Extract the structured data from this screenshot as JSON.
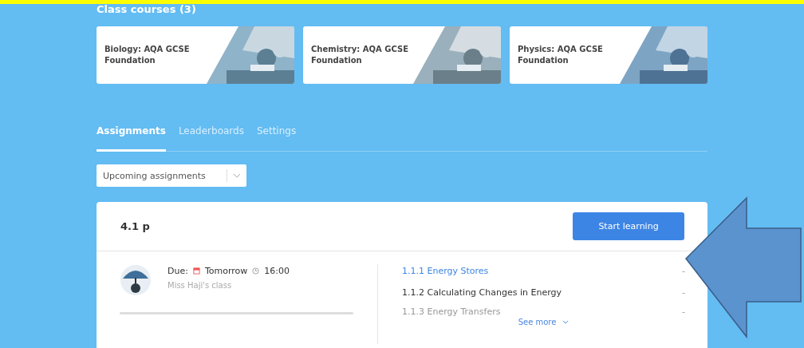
{
  "courses_heading": "Class courses (3)",
  "courses": [
    {
      "title": "Biology: AQA GCSE Foundation",
      "kind": "picture"
    },
    {
      "title": "Chemistry: AQA GCSE Foundation",
      "kind": "picture"
    },
    {
      "title": "Physics: AQA GCSE Foundation",
      "kind": "picture"
    }
  ],
  "tabs": [
    {
      "label": "Assignments",
      "selected": true
    },
    {
      "label": "Leaderboards",
      "selected": false
    },
    {
      "label": "Settings",
      "selected": false
    }
  ],
  "filter": {
    "value": "Upcoming assignments"
  },
  "assignment": {
    "title": "4.1 p",
    "button": "Start learning",
    "due_label": "Due:",
    "due_day": "Tomorrow",
    "due_time": "16:00",
    "class_name": "Miss Haji's class",
    "progress": {
      "level": 0
    },
    "topics": [
      {
        "label": "1.1.1 Energy Stores",
        "kind": "current",
        "mark": "-"
      },
      {
        "label": "1.1.2 Calculating Changes in Energy",
        "kind": "normal",
        "mark": "-"
      },
      {
        "label": "1.1.3 Energy Transfers",
        "kind": "faded",
        "mark": "-"
      }
    ],
    "see_more": "See more"
  }
}
